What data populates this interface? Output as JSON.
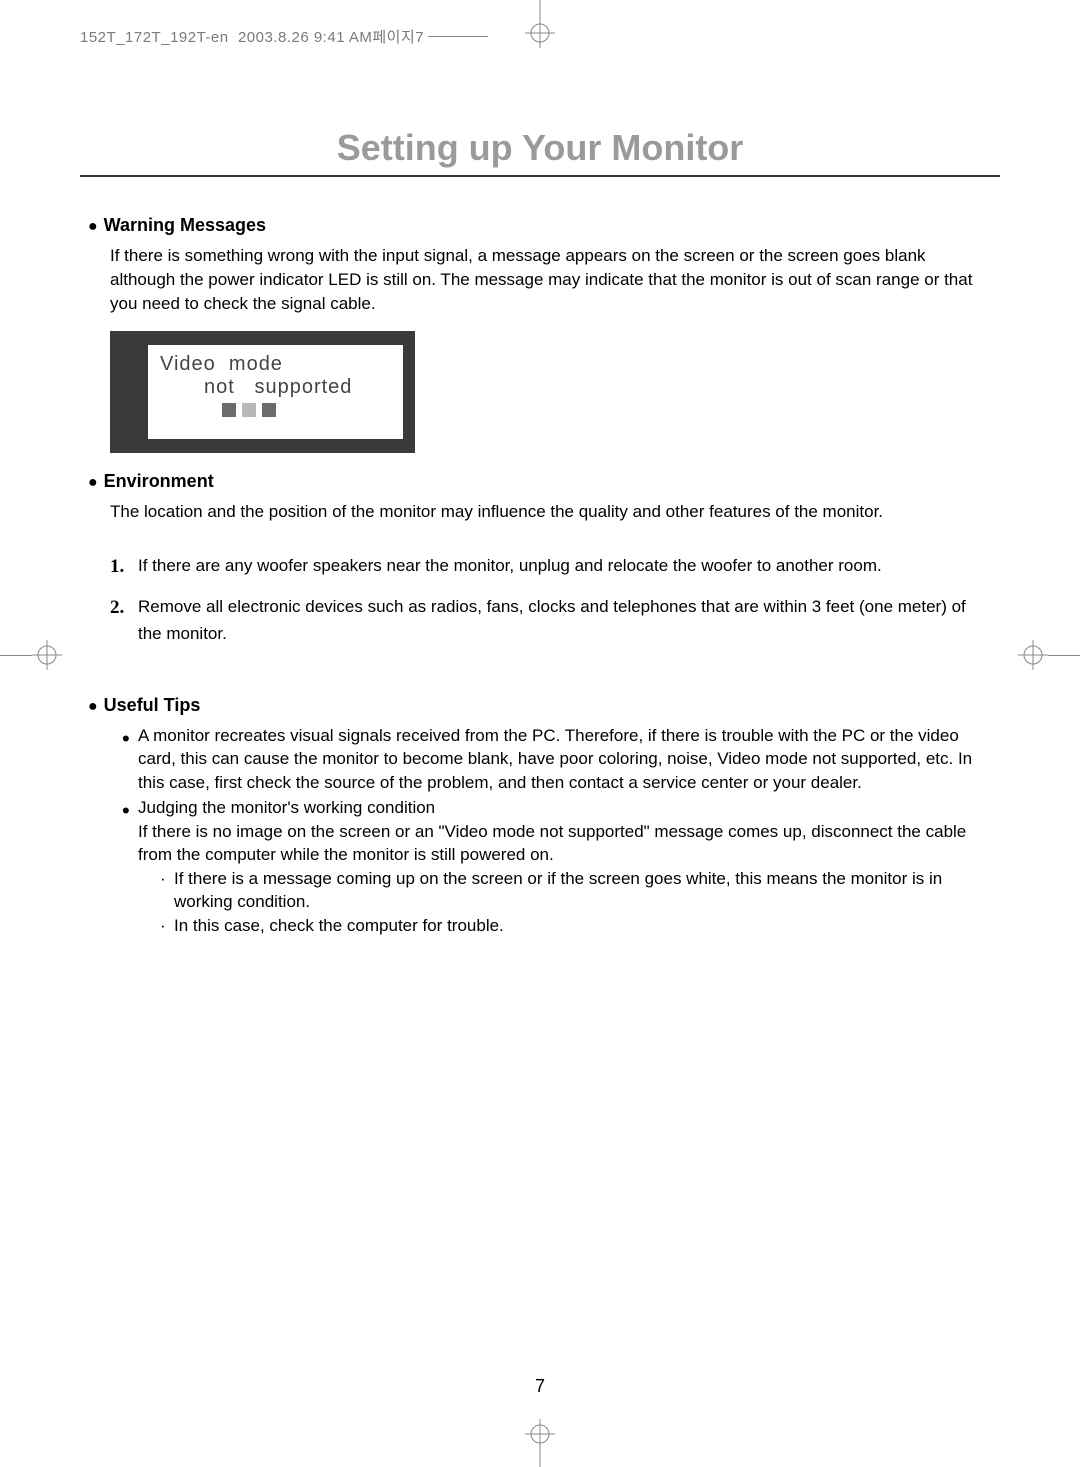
{
  "file_header": "152T_172T_192T-en  2003.8.26 9:41 AM페이지7",
  "title": "Setting up Your Monitor",
  "sections": {
    "warning": {
      "heading": "Warning Messages",
      "body": "If there is something wrong with the input signal, a message appears on the screen or the screen goes blank although the power indicator LED is still on. The message may indicate that the monitor is out of scan range or that you need to check the signal cable.",
      "monitor_msg": {
        "line1": "Video  mode",
        "line2": "not   supported"
      }
    },
    "environment": {
      "heading": "Environment",
      "body": "The location and the position of the monitor may influence the quality and other features of the monitor.",
      "items": [
        "If there are any woofer speakers near the monitor, unplug and relocate the woofer to another room.",
        "Remove all electronic devices such as radios, fans, clocks and telephones that are within 3 feet (one meter) of the monitor."
      ]
    },
    "tips": {
      "heading": "Useful Tips",
      "items": [
        "A monitor recreates visual signals received from the PC. Therefore, if there is trouble with the PC or the video card, this can cause the monitor to become blank, have poor coloring, noise, Video mode not supported, etc. In this case, first check the source of the problem, and then contact a service center or your dealer."
      ],
      "judging_head": "Judging the monitor's working condition",
      "judging_body": "If there is no image on the screen or an \"Video mode not supported\" message comes up, disconnect the cable from the computer while the monitor is still powered on.",
      "sub_items": [
        "If there is a message coming up on the screen or if the screen goes white, this means the monitor is in working condition.",
        "In this case, check the computer for trouble."
      ]
    }
  },
  "page_number": "7"
}
